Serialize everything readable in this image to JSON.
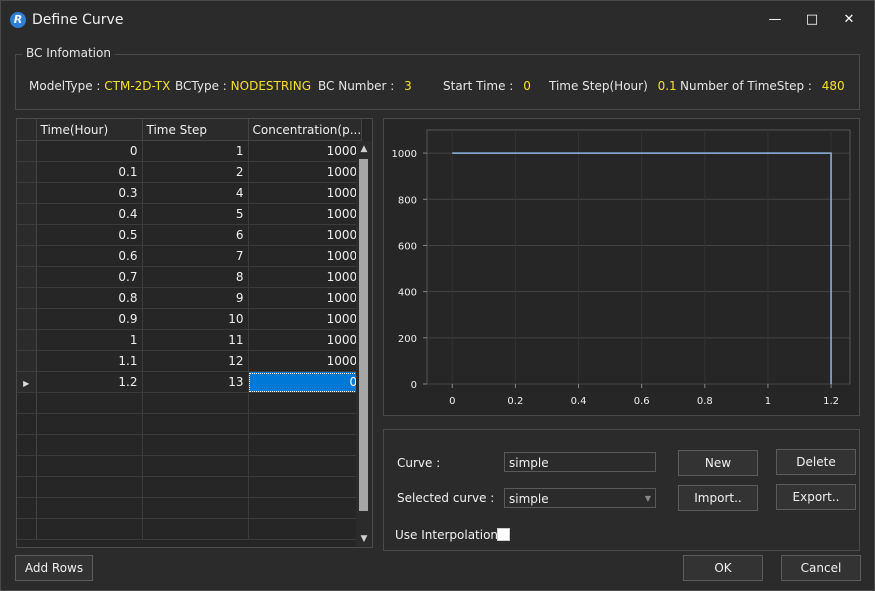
{
  "window": {
    "title": "Define Curve",
    "icon": "R-app-icon"
  },
  "bc_info": {
    "legend": "BC Infomation",
    "model_type_label": "ModelType :",
    "model_type": "CTM-2D-TX",
    "bc_type_label": "BCType :",
    "bc_type": "NODESTRING",
    "bc_number_label": "BC Number :",
    "bc_number": "3",
    "start_time_label": "Start Time :",
    "start_time": "0",
    "time_step_label": "Time Step(Hour)",
    "time_step": "0.1",
    "num_steps_label": "Number of TimeStep :",
    "num_steps": "480",
    "value_color": "#f5e12b"
  },
  "table": {
    "headers": [
      "Time(Hour)",
      "Time Step",
      "Concentration(p..."
    ],
    "rows": [
      [
        "0",
        "1",
        "1000"
      ],
      [
        "0.1",
        "2",
        "1000"
      ],
      [
        "0.3",
        "4",
        "1000"
      ],
      [
        "0.4",
        "5",
        "1000"
      ],
      [
        "0.5",
        "6",
        "1000"
      ],
      [
        "0.6",
        "7",
        "1000"
      ],
      [
        "0.7",
        "8",
        "1000"
      ],
      [
        "0.8",
        "9",
        "1000"
      ],
      [
        "0.9",
        "10",
        "1000"
      ],
      [
        "1",
        "11",
        "1000"
      ],
      [
        "1.1",
        "12",
        "1000"
      ],
      [
        "1.2",
        "13",
        "0"
      ]
    ]
  },
  "chart_data": {
    "type": "line",
    "x": [
      0,
      1.2,
      1.2
    ],
    "y": [
      1000,
      1000,
      0
    ],
    "xlim": [
      -0.08,
      1.26
    ],
    "ylim": [
      0,
      1100
    ],
    "xticks": [
      "0",
      "0.2",
      "0.4",
      "0.6",
      "0.8",
      "1",
      "1.2"
    ],
    "yticks": [
      "0",
      "200",
      "400",
      "600",
      "800",
      "1000"
    ],
    "line_color": "#8fb8e8",
    "grid": true
  },
  "controls": {
    "curve_label": "Curve :",
    "curve_value": "simple",
    "selected_label": "Selected curve :",
    "selected_value": "simple",
    "interp_label": "Use Interpolation",
    "new": "New",
    "delete": "Delete",
    "import": "Import..",
    "export": "Export.."
  },
  "footer": {
    "add_rows": "Add Rows",
    "ok": "OK",
    "cancel": "Cancel"
  }
}
